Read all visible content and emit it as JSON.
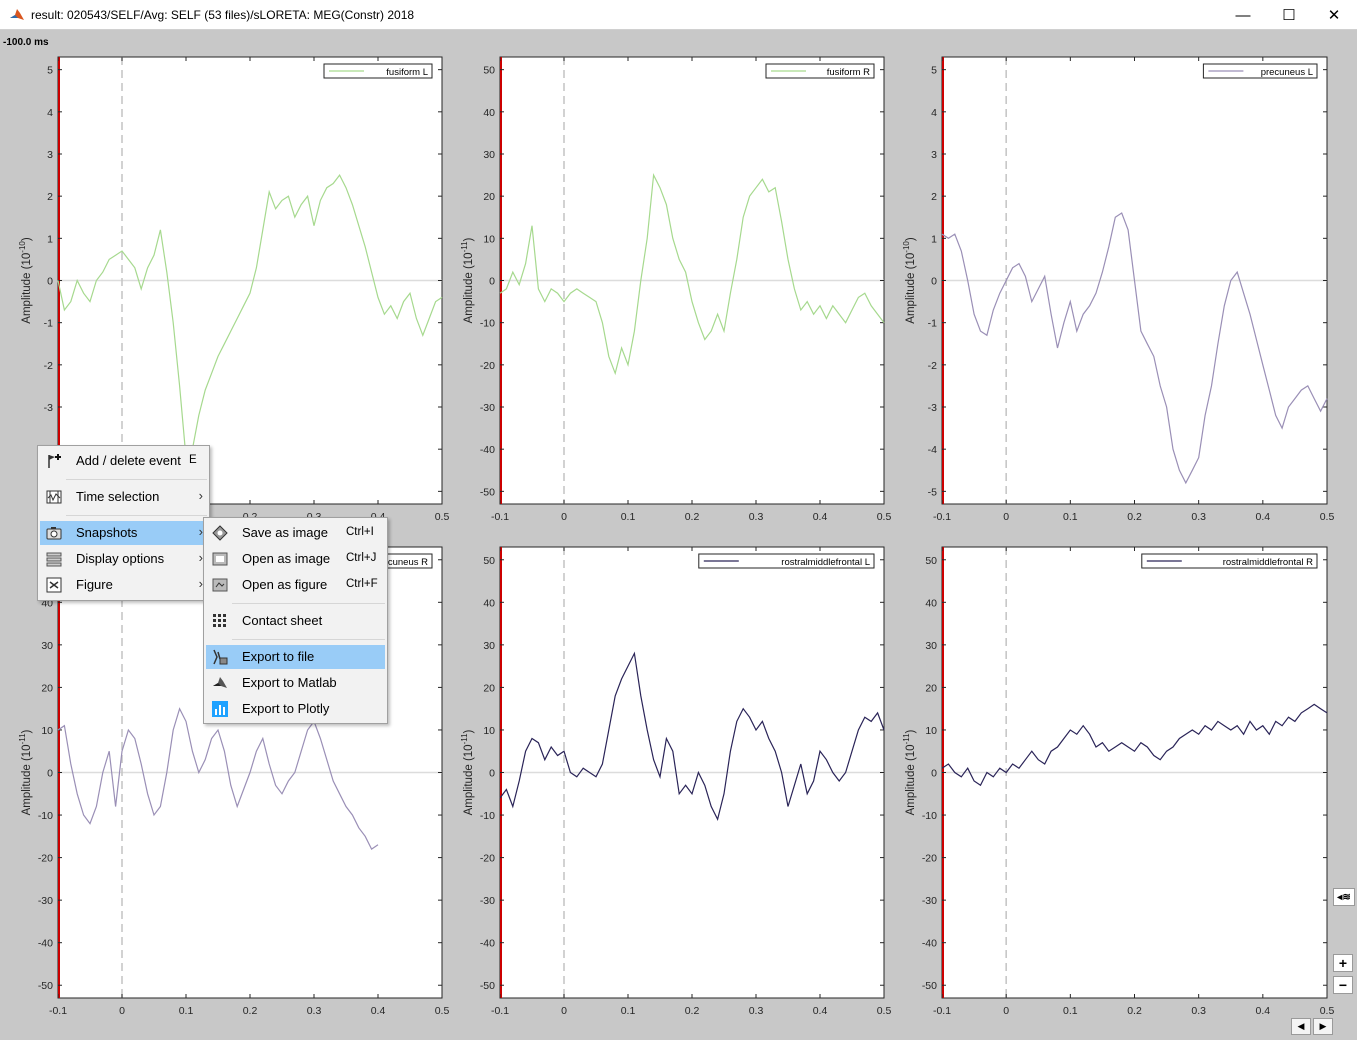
{
  "window": {
    "title": "result: 020543/SELF/Avg: SELF (53 files)/sLORETA: MEG(Constr) 2018",
    "minimize": "—",
    "maximize": "☐",
    "close": "✕"
  },
  "time_label": "-100.0 ms",
  "colors": {
    "green": "#a6d98e",
    "lavender": "#9a8fb6",
    "navy": "#2a2458",
    "red_axis": "#cc0000",
    "highlight": "#99ccf7"
  },
  "chart_data": [
    {
      "type": "line",
      "title": "",
      "legend": "fusiform L",
      "legend_placement": "top-right",
      "ylabel": "Amplitude (10-10)",
      "ylim": [
        -5.3,
        5.3
      ],
      "yticks": [
        5,
        4,
        3,
        2,
        1,
        0,
        -1,
        -2,
        -3,
        -4,
        -5
      ],
      "xlim": [
        -0.1,
        0.5
      ],
      "xticks": [
        -0.1,
        0,
        0.1,
        0.2,
        0.3,
        0.4,
        0.5
      ],
      "color": "lavender_green",
      "x": [
        -0.1,
        -0.09,
        -0.08,
        -0.07,
        -0.06,
        -0.05,
        -0.04,
        -0.03,
        -0.02,
        -0.01,
        0,
        0.01,
        0.02,
        0.03,
        0.04,
        0.05,
        0.06,
        0.07,
        0.08,
        0.09,
        0.1,
        0.11,
        0.12,
        0.13,
        0.14,
        0.15,
        0.16,
        0.17,
        0.18,
        0.19,
        0.2,
        0.21,
        0.22,
        0.23,
        0.24,
        0.25,
        0.26,
        0.27,
        0.28,
        0.29,
        0.3,
        0.31,
        0.32,
        0.33,
        0.34,
        0.35,
        0.36,
        0.37,
        0.38,
        0.39,
        0.4,
        0.41,
        0.42,
        0.43,
        0.44,
        0.45,
        0.46,
        0.47,
        0.48,
        0.49,
        0.5
      ],
      "y": [
        0,
        -0.7,
        -0.5,
        0,
        -0.3,
        -0.5,
        0,
        0.2,
        0.5,
        0.6,
        0.7,
        0.5,
        0.3,
        -0.2,
        0.3,
        0.6,
        1.2,
        0.2,
        -1,
        -2.5,
        -4.2,
        -4,
        -3.2,
        -2.6,
        -2.2,
        -1.8,
        -1.5,
        -1.2,
        -0.9,
        -0.6,
        -0.3,
        0.3,
        1.2,
        2.1,
        1.7,
        1.9,
        2,
        1.5,
        1.8,
        2,
        1.3,
        1.9,
        2.2,
        2.3,
        2.5,
        2.2,
        1.8,
        1.3,
        0.8,
        0.2,
        -0.4,
        -0.8,
        -0.6,
        -0.9,
        -0.5,
        -0.3,
        -0.9,
        -1.3,
        -0.9,
        -0.5,
        -0.4
      ]
    },
    {
      "type": "line",
      "title": "",
      "legend": "fusiform R",
      "legend_placement": "top-right",
      "ylabel": "Amplitude (10-11)",
      "ylim": [
        -53,
        53
      ],
      "yticks": [
        50,
        40,
        30,
        20,
        10,
        0,
        -10,
        -20,
        -30,
        -40,
        -50
      ],
      "xlim": [
        -0.1,
        0.5
      ],
      "xticks": [
        -0.1,
        0,
        0.1,
        0.2,
        0.3,
        0.4,
        0.5
      ],
      "color": "green",
      "x": [
        -0.1,
        -0.09,
        -0.08,
        -0.07,
        -0.06,
        -0.05,
        -0.04,
        -0.03,
        -0.02,
        -0.01,
        0,
        0.01,
        0.02,
        0.03,
        0.04,
        0.05,
        0.06,
        0.07,
        0.08,
        0.09,
        0.1,
        0.11,
        0.12,
        0.13,
        0.14,
        0.15,
        0.16,
        0.17,
        0.18,
        0.19,
        0.2,
        0.21,
        0.22,
        0.23,
        0.24,
        0.25,
        0.26,
        0.27,
        0.28,
        0.29,
        0.3,
        0.31,
        0.32,
        0.33,
        0.34,
        0.35,
        0.36,
        0.37,
        0.38,
        0.39,
        0.4,
        0.41,
        0.42,
        0.43,
        0.44,
        0.45,
        0.46,
        0.47,
        0.48,
        0.49,
        0.5
      ],
      "y": [
        -3,
        -2,
        2,
        -1,
        4,
        13,
        -2,
        -5,
        -2,
        -3,
        -5,
        -3,
        -2,
        -3,
        -4,
        -5,
        -10,
        -18,
        -22,
        -16,
        -20,
        -12,
        0,
        10,
        25,
        22,
        18,
        10,
        5,
        2,
        -5,
        -10,
        -14,
        -12,
        -8,
        -12,
        -3,
        5,
        15,
        20,
        22,
        24,
        21,
        22,
        14,
        5,
        -2,
        -7,
        -5,
        -8,
        -6,
        -9,
        -6,
        -8,
        -10,
        -7,
        -4,
        -3,
        -6,
        -8,
        -10
      ]
    },
    {
      "type": "line",
      "title": "",
      "legend": "precuneus L",
      "legend_placement": "top-right",
      "ylabel": "Amplitude (10-10)",
      "ylim": [
        -5.3,
        5.3
      ],
      "yticks": [
        5,
        4,
        3,
        2,
        1,
        0,
        -1,
        -2,
        -3,
        -4,
        -5
      ],
      "xlim": [
        -0.1,
        0.5
      ],
      "xticks": [
        -0.1,
        0,
        0.1,
        0.2,
        0.3,
        0.4,
        0.5
      ],
      "color": "lavender",
      "x": [
        -0.1,
        -0.09,
        -0.08,
        -0.07,
        -0.06,
        -0.05,
        -0.04,
        -0.03,
        -0.02,
        -0.01,
        0,
        0.01,
        0.02,
        0.03,
        0.04,
        0.05,
        0.06,
        0.07,
        0.08,
        0.09,
        0.1,
        0.11,
        0.12,
        0.13,
        0.14,
        0.15,
        0.16,
        0.17,
        0.18,
        0.19,
        0.2,
        0.21,
        0.22,
        0.23,
        0.24,
        0.25,
        0.26,
        0.27,
        0.28,
        0.29,
        0.3,
        0.31,
        0.32,
        0.33,
        0.34,
        0.35,
        0.36,
        0.37,
        0.38,
        0.39,
        0.4,
        0.41,
        0.42,
        0.43,
        0.44,
        0.45,
        0.46,
        0.47,
        0.48,
        0.49,
        0.5
      ],
      "y": [
        1.1,
        1,
        1.1,
        0.7,
        0,
        -0.8,
        -1.2,
        -1.3,
        -0.7,
        -0.3,
        0,
        0.3,
        0.4,
        0.1,
        -0.5,
        -0.2,
        0.1,
        -0.8,
        -1.6,
        -1,
        -0.5,
        -1.2,
        -0.8,
        -0.6,
        -0.3,
        0.2,
        0.8,
        1.5,
        1.6,
        1.2,
        0,
        -1.2,
        -1.5,
        -1.8,
        -2.5,
        -3,
        -4,
        -4.5,
        -4.8,
        -4.5,
        -4.2,
        -3.2,
        -2.5,
        -1.5,
        -0.6,
        0,
        0.2,
        -0.3,
        -0.8,
        -1.4,
        -2,
        -2.6,
        -3.2,
        -3.5,
        -3,
        -2.8,
        -2.6,
        -2.5,
        -2.8,
        -3.1,
        -2.8
      ]
    },
    {
      "type": "line",
      "title": "",
      "legend": "precuneus R",
      "legend_placement": "top-right",
      "ylabel": "Amplitude (10-11)",
      "ylim": [
        -53,
        53
      ],
      "yticks": [
        50,
        40,
        30,
        20,
        10,
        0,
        -10,
        -20,
        -30,
        -40,
        -50
      ],
      "xlim": [
        -0.1,
        0.5
      ],
      "xticks": [
        -0.1,
        0,
        0.1,
        0.2,
        0.3,
        0.4,
        0.5
      ],
      "color": "lavender",
      "x": [
        -0.1,
        -0.09,
        -0.08,
        -0.07,
        -0.06,
        -0.05,
        -0.04,
        -0.03,
        -0.02,
        -0.01,
        0,
        0.01,
        0.02,
        0.03,
        0.04,
        0.05,
        0.06,
        0.07,
        0.08,
        0.09,
        0.1,
        0.11,
        0.12,
        0.13,
        0.14,
        0.15,
        0.16,
        0.17,
        0.18,
        0.19,
        0.2,
        0.21,
        0.22,
        0.23,
        0.24,
        0.25,
        0.26,
        0.27,
        0.28,
        0.29,
        0.3,
        0.31,
        0.32,
        0.33,
        0.34,
        0.35,
        0.36,
        0.37,
        0.38,
        0.39,
        0.4,
        0.41,
        0.42,
        0.43,
        0.44,
        0.45,
        0.46,
        0.47,
        0.48,
        0.49,
        0.5
      ],
      "y": [
        10,
        11,
        2,
        -5,
        -10,
        -12,
        -8,
        0,
        5,
        -8,
        5,
        10,
        8,
        2,
        -5,
        -10,
        -8,
        0,
        10,
        15,
        12,
        5,
        0,
        3,
        8,
        10,
        5,
        -3,
        -8,
        -4,
        0,
        5,
        8,
        2,
        -3,
        -5,
        -2,
        0,
        5,
        10,
        12,
        8,
        3,
        -2,
        -5,
        -8,
        -10,
        -13,
        -15,
        -18,
        -17
      ]
    },
    {
      "type": "line",
      "title": "",
      "legend": "rostralmiddlefrontal L",
      "legend_placement": "top-right",
      "ylabel": "Amplitude (10-11)",
      "ylim": [
        -53,
        53
      ],
      "yticks": [
        50,
        40,
        30,
        20,
        10,
        0,
        -10,
        -20,
        -30,
        -40,
        -50
      ],
      "xlim": [
        -0.1,
        0.5
      ],
      "xticks": [
        -0.1,
        0,
        0.1,
        0.2,
        0.3,
        0.4,
        0.5
      ],
      "color": "navy",
      "x": [
        -0.1,
        -0.09,
        -0.08,
        -0.07,
        -0.06,
        -0.05,
        -0.04,
        -0.03,
        -0.02,
        -0.01,
        0,
        0.01,
        0.02,
        0.03,
        0.04,
        0.05,
        0.06,
        0.07,
        0.08,
        0.09,
        0.1,
        0.11,
        0.12,
        0.13,
        0.14,
        0.15,
        0.16,
        0.17,
        0.18,
        0.19,
        0.2,
        0.21,
        0.22,
        0.23,
        0.24,
        0.25,
        0.26,
        0.27,
        0.28,
        0.29,
        0.3,
        0.31,
        0.32,
        0.33,
        0.34,
        0.35,
        0.36,
        0.37,
        0.38,
        0.39,
        0.4,
        0.41,
        0.42,
        0.43,
        0.44,
        0.45,
        0.46,
        0.47,
        0.48,
        0.49,
        0.5
      ],
      "y": [
        -6,
        -4,
        -8,
        -2,
        5,
        8,
        7,
        3,
        6,
        4,
        5,
        0,
        -1,
        1,
        0,
        -1,
        2,
        10,
        18,
        22,
        25,
        28,
        18,
        10,
        3,
        -1,
        8,
        5,
        -5,
        -3,
        -5,
        0,
        -3,
        -8,
        -11,
        -5,
        5,
        12,
        15,
        13,
        10,
        12,
        8,
        5,
        0,
        -8,
        -3,
        2,
        -5,
        -2,
        5,
        3,
        0,
        -2,
        0,
        5,
        10,
        13,
        12,
        14,
        10
      ]
    },
    {
      "type": "line",
      "title": "",
      "legend": "rostralmiddlefrontal R",
      "legend_placement": "top-right",
      "ylabel": "Amplitude (10-11)",
      "ylim": [
        -53,
        53
      ],
      "yticks": [
        50,
        40,
        30,
        20,
        10,
        0,
        -10,
        -20,
        -30,
        -40,
        -50
      ],
      "xlim": [
        -0.1,
        0.5
      ],
      "xticks": [
        -0.1,
        0,
        0.1,
        0.2,
        0.3,
        0.4,
        0.5
      ],
      "color": "navy",
      "x": [
        -0.1,
        -0.09,
        -0.08,
        -0.07,
        -0.06,
        -0.05,
        -0.04,
        -0.03,
        -0.02,
        -0.01,
        0,
        0.01,
        0.02,
        0.03,
        0.04,
        0.05,
        0.06,
        0.07,
        0.08,
        0.09,
        0.1,
        0.11,
        0.12,
        0.13,
        0.14,
        0.15,
        0.16,
        0.17,
        0.18,
        0.19,
        0.2,
        0.21,
        0.22,
        0.23,
        0.24,
        0.25,
        0.26,
        0.27,
        0.28,
        0.29,
        0.3,
        0.31,
        0.32,
        0.33,
        0.34,
        0.35,
        0.36,
        0.37,
        0.38,
        0.39,
        0.4,
        0.41,
        0.42,
        0.43,
        0.44,
        0.45,
        0.46,
        0.47,
        0.48,
        0.49,
        0.5
      ],
      "y": [
        1,
        2,
        0,
        -1,
        1,
        -2,
        -3,
        0,
        -1,
        1,
        0,
        2,
        1,
        3,
        5,
        3,
        2,
        5,
        6,
        8,
        10,
        9,
        11,
        9,
        6,
        7,
        5,
        6,
        7,
        6,
        5,
        7,
        6,
        4,
        3,
        5,
        6,
        8,
        9,
        10,
        9,
        11,
        10,
        12,
        11,
        10,
        11,
        9,
        12,
        10,
        11,
        9,
        12,
        11,
        13,
        12,
        14,
        15,
        16,
        15,
        14
      ]
    }
  ],
  "context_menu": {
    "items": [
      {
        "label": "Add / delete event",
        "shortcut": "E",
        "icon": "event-flag-icon"
      },
      {
        "label": "Time selection",
        "icon": "time-selection-icon",
        "submenu": true
      },
      {
        "label": "Snapshots",
        "icon": "camera-icon",
        "submenu": true,
        "highlighted": true
      },
      {
        "label": "Display options",
        "icon": "display-options-icon",
        "submenu": true
      },
      {
        "label": "Figure",
        "icon": "figure-icon",
        "submenu": true
      }
    ],
    "arrow": "›"
  },
  "snapshots_menu": {
    "items": [
      {
        "label": "Save as image",
        "shortcut": "Ctrl+I",
        "icon": "save-image-icon"
      },
      {
        "label": "Open as image",
        "shortcut": "Ctrl+J",
        "icon": "open-image-icon"
      },
      {
        "label": "Open as figure",
        "shortcut": "Ctrl+F",
        "icon": "open-figure-icon"
      },
      {
        "label": "Contact sheet",
        "icon": "contact-sheet-icon"
      },
      {
        "label": "Export to file",
        "icon": "export-file-icon",
        "highlighted": true
      },
      {
        "label": "Export to Matlab",
        "icon": "matlab-icon"
      },
      {
        "label": "Export to Plotly",
        "icon": "plotly-icon"
      }
    ]
  },
  "side_controls": {
    "zoom_in": "+",
    "zoom_out": "−",
    "prev": "◀",
    "next": "▶",
    "collapse": "◂≋"
  }
}
